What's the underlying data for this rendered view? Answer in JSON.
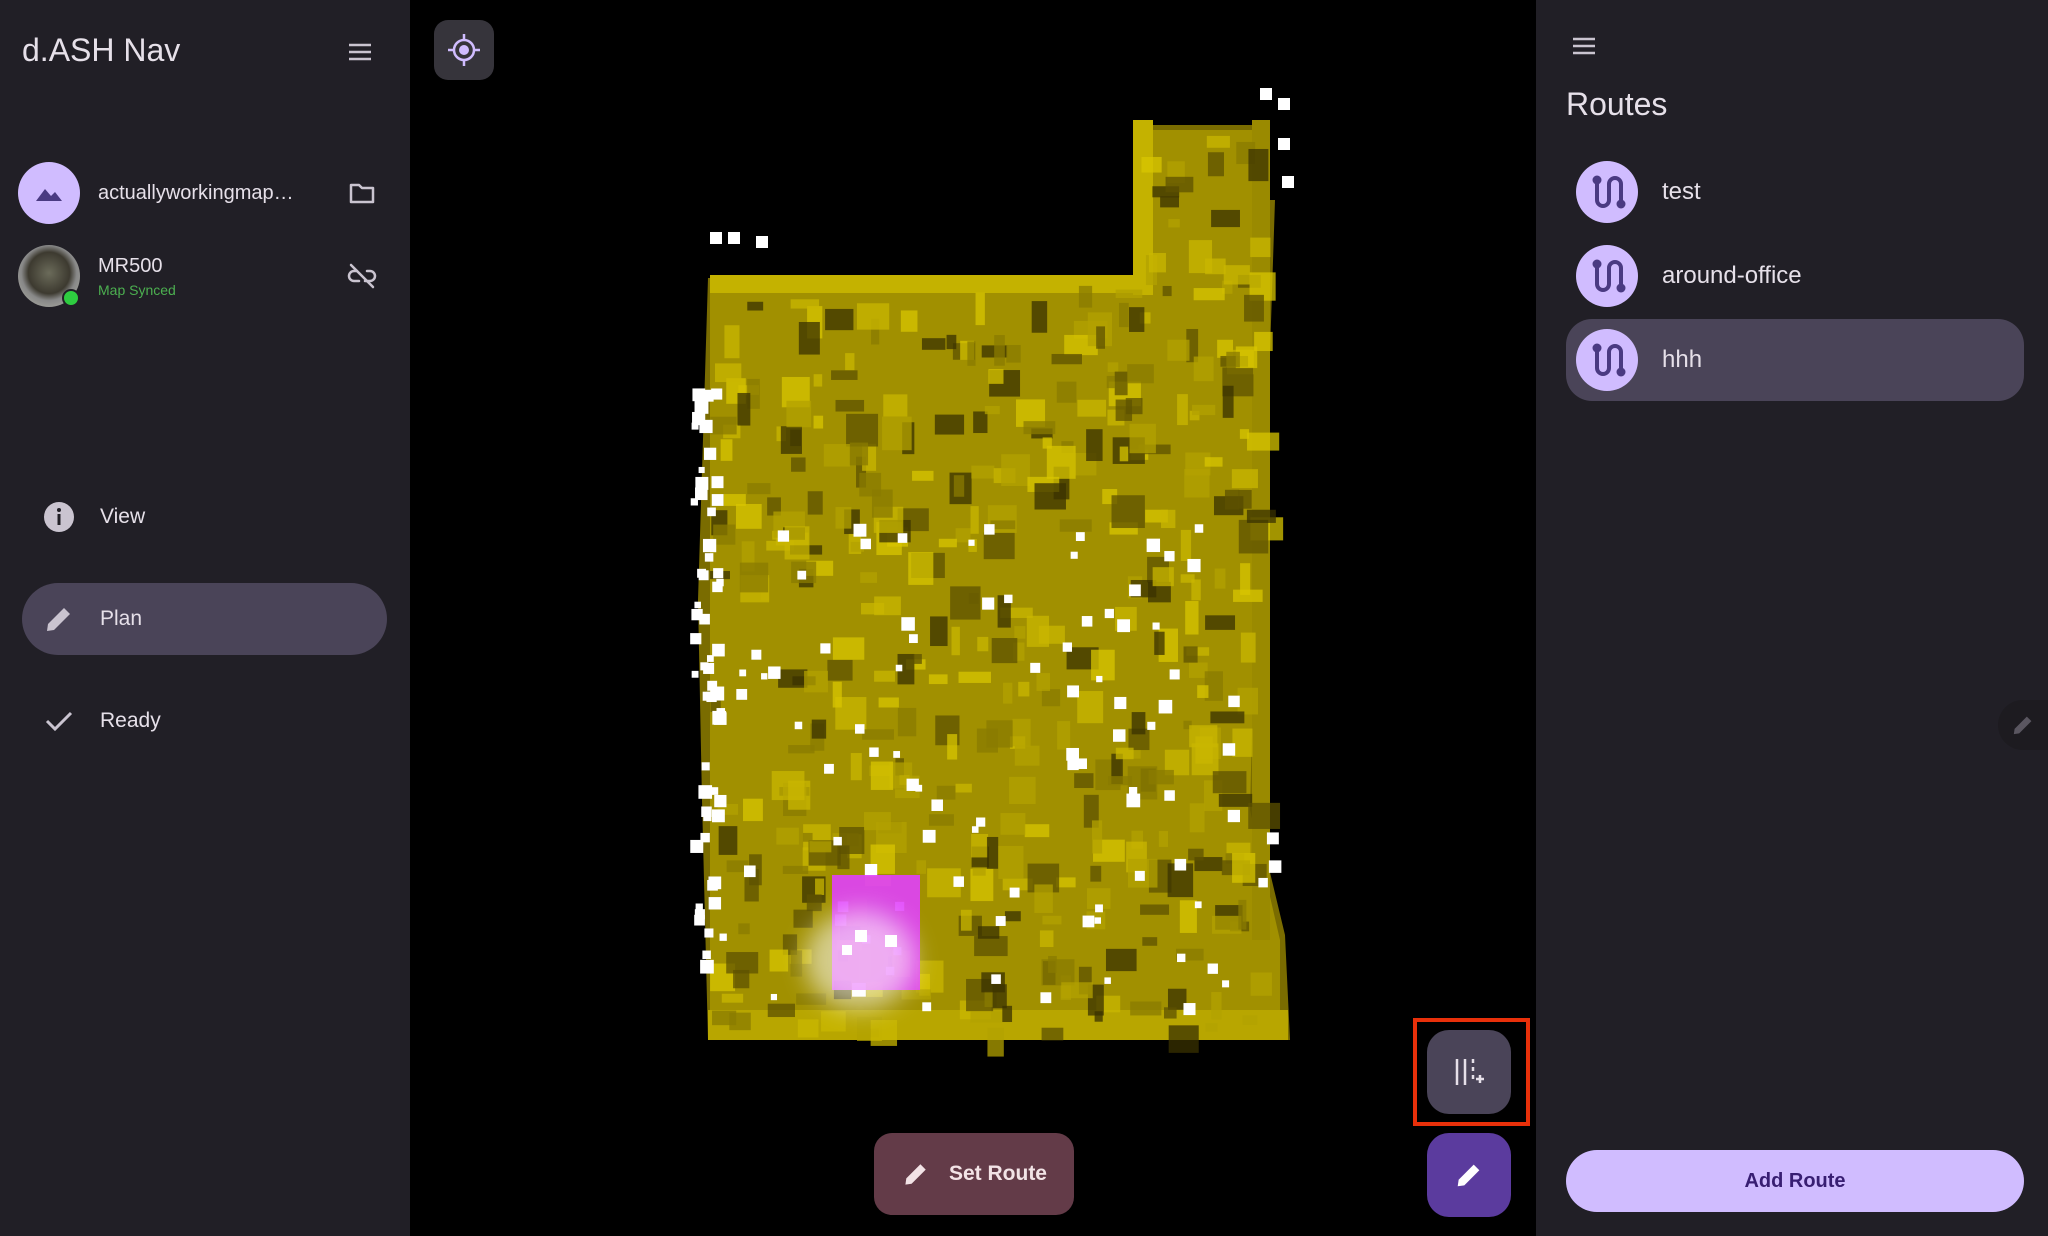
{
  "app": {
    "title": "d.ASH Nav"
  },
  "left_drawer": {
    "map_item": {
      "label": "actuallyworkingmap…",
      "icon": "map-mountain-icon",
      "action_icon": "folder-icon"
    },
    "robot_item": {
      "name": "MR500",
      "status": "Map Synced",
      "status_color": "#4caf50",
      "action_icon": "link-off-icon"
    },
    "modes": [
      {
        "label": "View",
        "icon": "info-icon",
        "active": false
      },
      {
        "label": "Plan",
        "icon": "pencil-icon",
        "active": true
      },
      {
        "label": "Ready",
        "icon": "check-icon",
        "active": false
      }
    ]
  },
  "map": {
    "locate_icon": "gps-crosshair-icon",
    "set_route_label": "Set Route",
    "waypoint_icon": "add-waypoint-icon",
    "edit_icon": "pencil-icon",
    "point_cloud_color": "#b5a400",
    "robot_marker_color": "#e040fb"
  },
  "right_panel": {
    "title": "Routes",
    "routes": [
      {
        "label": "test",
        "active": false
      },
      {
        "label": "around-office",
        "active": false
      },
      {
        "label": "hhh",
        "active": true
      }
    ],
    "add_route_label": "Add Route"
  },
  "colors": {
    "accent": "#d0bcff",
    "surface": "#211f26",
    "selected": "#4a4458",
    "highlight": "#e8300a"
  }
}
